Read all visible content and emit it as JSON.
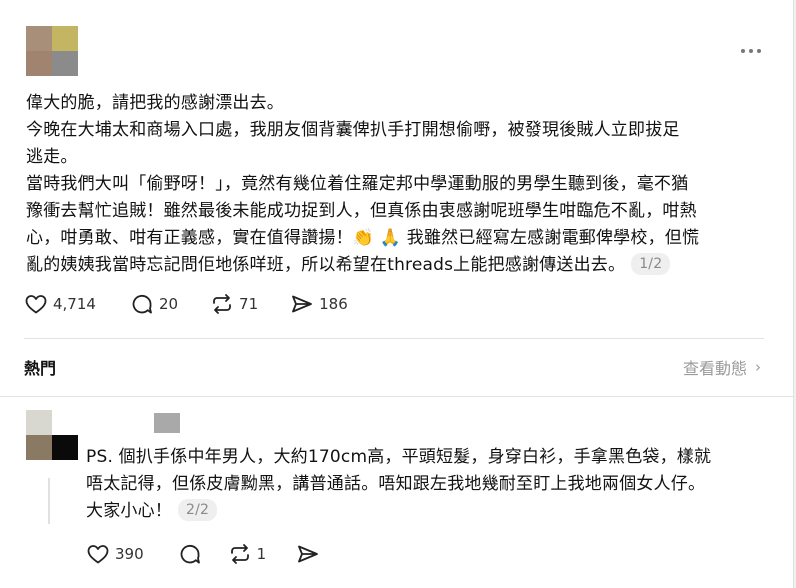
{
  "post": {
    "lines": [
      "偉大的脆，請把我的感謝漂出去。",
      "今晚在大埔太和商場入口處，我朋友個背囊俾扒手打開想偷嘢，被發現後賊人立即拔足",
      "逃走。",
      "當時我們大叫「偷野呀！」，竟然有幾位着住羅定邦中學運動服的男學生聽到後，毫不猶",
      "豫衝去幫忙追賊！雖然最後未能成功捉到人，但真係由衷感謝呢班學生咁臨危不亂，咁熱",
      "心，咁勇敢、咁有正義感，實在值得讚揚！"
    ],
    "emoji_line_before": "心，咁勇敢、咁有正義感，實在值得讚揚！",
    "emoji_clap": "👏",
    "emoji_pray": "🙏",
    "emoji_line_after": " 我雖然已經寫左感謝電郵俾學校，但慌",
    "last_line": "亂的姨姨我當時忘記問佢地係咩班，所以希望在threads上能把感謝傳送出去。",
    "page_indicator": "1/2",
    "likes": "4,714",
    "comments": "20",
    "reposts": "71",
    "shares": "186"
  },
  "section": {
    "hot_label": "熱門",
    "view_activity": "查看動態"
  },
  "reply": {
    "lines": [
      "PS. 個扒手係中年男人，大約170cm高，平頭短髮，身穿白衫，手拿黑色袋，樣就",
      "唔太記得，但係皮膚黝黑，講普通話。唔知跟左我地幾耐至盯上我地兩個女人仔。",
      "大家小心！"
    ],
    "page_indicator": "2/2",
    "likes": "390",
    "reposts": "1"
  },
  "colors": {
    "avatar1": [
      "#a88f7a",
      "#c4b562",
      "#a08470",
      "#8b8b8b"
    ],
    "avatar2": [
      "#d8d8d0",
      "#ffffff",
      "#8a7a64",
      "#0a0a0a"
    ],
    "name_block": "#a9a9a9"
  }
}
